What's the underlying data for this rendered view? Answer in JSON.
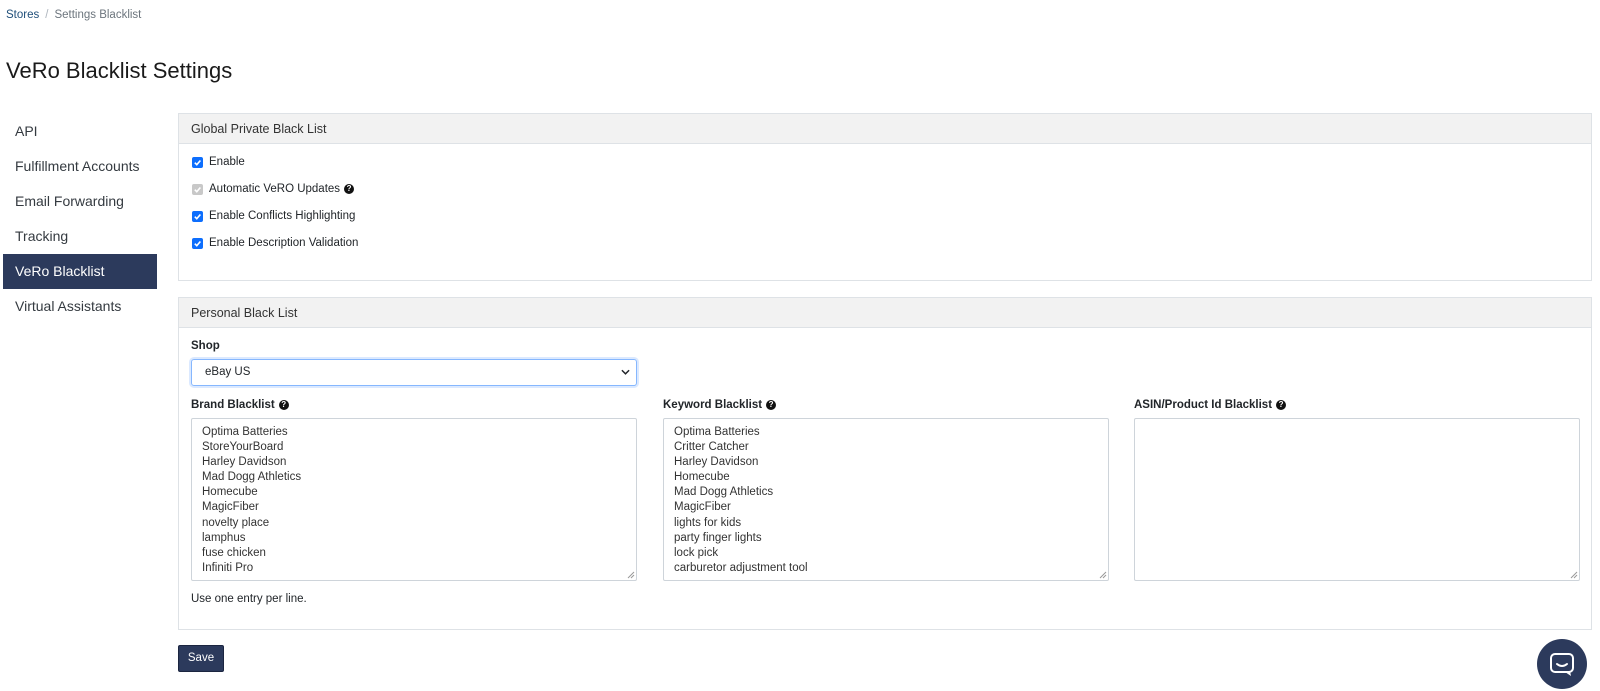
{
  "breadcrumb": {
    "root": "Stores",
    "current": "Settings Blacklist"
  },
  "page_title": "VeRo Blacklist Settings",
  "sidebar": {
    "items": [
      {
        "label": "API"
      },
      {
        "label": "Fulfillment Accounts"
      },
      {
        "label": "Email Forwarding"
      },
      {
        "label": "Tracking"
      },
      {
        "label": "VeRo Blacklist",
        "active": true
      },
      {
        "label": "Virtual Assistants"
      }
    ]
  },
  "global_list": {
    "header": "Global Private Black List",
    "options": [
      {
        "label": "Enable",
        "checked": true,
        "disabled": false
      },
      {
        "label": "Automatic VeRO Updates",
        "checked": true,
        "disabled": true,
        "help": true
      },
      {
        "label": "Enable Conflicts Highlighting",
        "checked": true,
        "disabled": false
      },
      {
        "label": "Enable Description Validation",
        "checked": true,
        "disabled": false
      }
    ]
  },
  "personal_list": {
    "header": "Personal Black List",
    "shop_label": "Shop",
    "shop_value": "eBay US",
    "brand_label": "Brand Blacklist",
    "brand_entries": [
      "Optima Batteries",
      "StoreYourBoard",
      "Harley Davidson",
      "Mad Dogg Athletics",
      "Homecube",
      "MagicFiber",
      "novelty place",
      "lamphus",
      "fuse chicken",
      "Infiniti Pro"
    ],
    "keyword_label": "Keyword Blacklist",
    "keyword_entries": [
      "Optima Batteries",
      "Critter Catcher",
      "Harley Davidson",
      "Homecube",
      "Mad Dogg Athletics",
      "MagicFiber",
      "lights for kids",
      "party finger lights",
      "lock pick",
      "carburetor adjustment tool"
    ],
    "asin_label": "ASIN/Product Id Blacklist",
    "asin_entries": [],
    "help_text": "Use one entry per line."
  },
  "save_label": "Save",
  "colors": {
    "primary": "#2c3a5c",
    "checkbox": "#0d6efd",
    "header_bg": "#f2f2f2"
  },
  "icons": {
    "help": "question-circle-icon",
    "chat": "chat-bubble-icon",
    "select": "chevron-down-icon"
  }
}
